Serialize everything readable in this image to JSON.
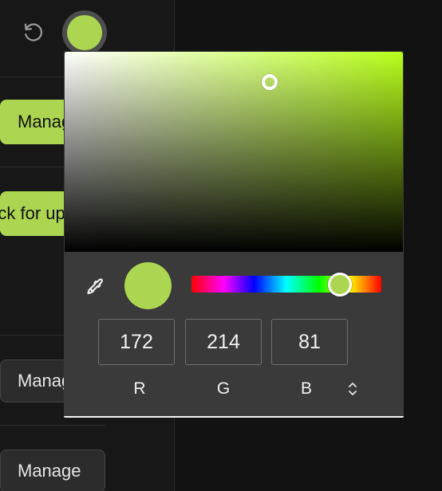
{
  "colors": {
    "selected": "#acd651",
    "hue_full": "#b8ff1a"
  },
  "icons": {
    "reset": "reset-icon",
    "eyedropper": "eyedropper-icon",
    "mode_toggle": "chevron-up-down-icon"
  },
  "background": {
    "buttons": [
      {
        "label": "Manage",
        "style": "green"
      },
      {
        "label": "Check for updates",
        "style": "green"
      },
      {
        "label": "Manage",
        "style": "dark"
      },
      {
        "label": "Manage",
        "style": "dark"
      }
    ]
  },
  "picker": {
    "saturation": 0.62,
    "brightness": 0.84,
    "hue_degrees": 79,
    "channels": [
      {
        "label": "R",
        "value": "172"
      },
      {
        "label": "G",
        "value": "214"
      },
      {
        "label": "B",
        "value": "81"
      }
    ]
  }
}
